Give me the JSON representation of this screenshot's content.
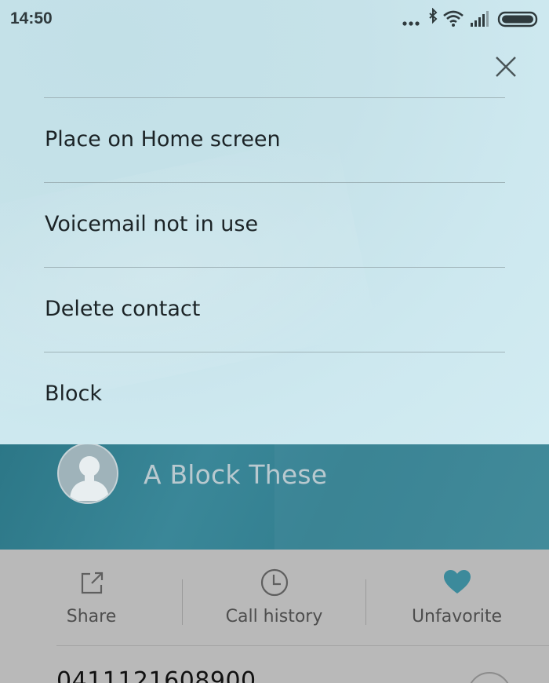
{
  "status_bar": {
    "time": "14:50",
    "icons": [
      "more-dots-icon",
      "bluetooth-icon",
      "wifi-icon",
      "signal-icon",
      "battery-icon"
    ]
  },
  "menu": {
    "close_icon": "close-icon",
    "items": [
      {
        "label": "Place on Home screen"
      },
      {
        "label": "Voicemail not in use"
      },
      {
        "label": "Delete contact"
      },
      {
        "label": "Block"
      }
    ]
  },
  "contact": {
    "name": "A Block These",
    "avatar_icon": "person-avatar-icon",
    "phone": "0411121608900"
  },
  "actions": [
    {
      "label": "Share",
      "icon": "share-icon"
    },
    {
      "label": "Call history",
      "icon": "clock-icon"
    },
    {
      "label": "Unfavorite",
      "icon": "heart-icon"
    }
  ],
  "colors": {
    "accent": "#3b8a9a",
    "header": "#337f90",
    "menu_bg": "#c9e5ec"
  }
}
